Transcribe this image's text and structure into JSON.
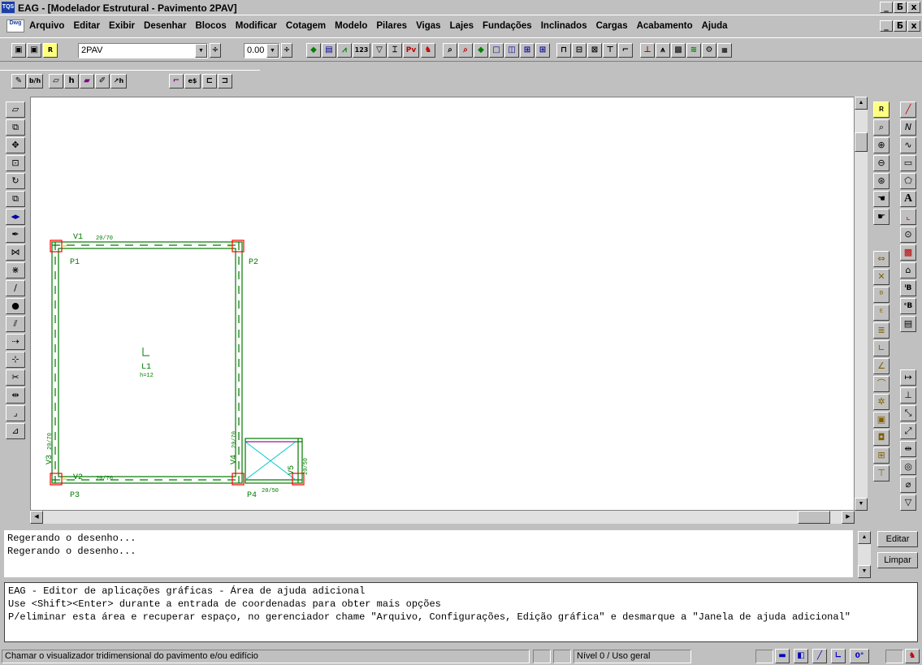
{
  "window": {
    "app_icon": "TQS",
    "title": "EAG - [Modelador Estrutural - Pavimento 2PAV]",
    "controls": [
      "_",
      "Б",
      "x"
    ]
  },
  "menubar": {
    "icon_label": "Dwg",
    "items": [
      "Arquivo",
      "Editar",
      "Exibir",
      "Desenhar",
      "Blocos",
      "Modificar",
      "Cotagem",
      "Modelo",
      "Pilares",
      "Vigas",
      "Lajes",
      "Fundações",
      "Inclinados",
      "Cargas",
      "Acabamento",
      "Ajuda"
    ]
  },
  "toolbar1": {
    "floor_combo_value": "2PAV",
    "level_combo_value": "0.00",
    "r_badge": "R",
    "num_button": "123",
    "pv_button": "Pv"
  },
  "toolbar2": {
    "buttons": [
      "b/h",
      "h",
      "↗h",
      "e$"
    ]
  },
  "drawing": {
    "beams": [
      {
        "name": "V1",
        "size": "20/70"
      },
      {
        "name": "V2",
        "size": "20/70"
      },
      {
        "name": "V3",
        "size": "20/70"
      },
      {
        "name": "V4",
        "size": "20/70"
      },
      {
        "name": "V5",
        "size": "20/50"
      }
    ],
    "pillars": [
      "P1",
      "P2",
      "P3",
      "P4"
    ],
    "p4_size": "20/50",
    "slab": {
      "name": "L1",
      "thickness": "h=12"
    }
  },
  "command_log": [
    "Regerando o desenho...",
    "Regerando o desenho..."
  ],
  "command_buttons": {
    "edit": "Editar",
    "clear": "Limpar"
  },
  "help": {
    "lines": [
      "EAG - Editor de aplicações gráficas - Área de ajuda adicional",
      "Use <Shift><Enter> durante a entrada de coordenadas para obter mais opções",
      "P/eliminar esta área e recuperar espaço, no gerenciador chame \"Arquivo, Configurações, Edição gráfica\" e desmarque a \"Janela de ajuda adicional\""
    ]
  },
  "statusbar": {
    "hint": "Chamar o visualizador tridimensional do pavimento e/ou edifício",
    "level": "Nível 0 / Uso geral",
    "angle": "0°"
  },
  "colors": {
    "beam_green": "#007a00",
    "pillar_red": "#ff0000",
    "opening_cyan": "#00c8c8",
    "toolbar_face": "#c0c0c0"
  }
}
